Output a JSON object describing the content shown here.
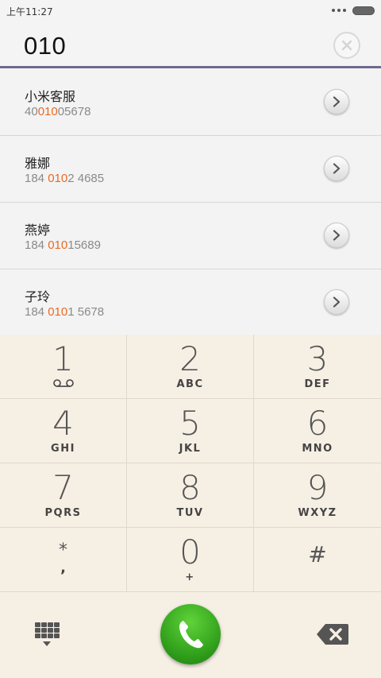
{
  "status_bar": {
    "time": "上午11:27",
    "more_icon": "dots-icon",
    "battery_icon": "battery-icon"
  },
  "dial": {
    "number": "010",
    "clear_icon": "close-icon"
  },
  "results": [
    {
      "name": "小米客服",
      "number_before": "40",
      "number_match": "010",
      "number_after": "05678"
    },
    {
      "name": "雅娜",
      "number_before": "184 ",
      "number_match": "010",
      "number_after": "2 4685"
    },
    {
      "name": "燕婷",
      "number_before": "184 ",
      "number_match": "010",
      "number_after": "15689"
    },
    {
      "name": "子玲",
      "number_before": "184 ",
      "number_match": "010",
      "number_after": "1 5678"
    }
  ],
  "keypad": {
    "keys": [
      {
        "digit": "1",
        "letters": ""
      },
      {
        "digit": "2",
        "letters": "ABC"
      },
      {
        "digit": "3",
        "letters": "DEF"
      },
      {
        "digit": "4",
        "letters": "GHI"
      },
      {
        "digit": "5",
        "letters": "JKL"
      },
      {
        "digit": "6",
        "letters": "MNO"
      },
      {
        "digit": "7",
        "letters": "PQRS"
      },
      {
        "digit": "8",
        "letters": "TUV"
      },
      {
        "digit": "9",
        "letters": "WXYZ"
      },
      {
        "digit": "*",
        "letters": ","
      },
      {
        "digit": "0",
        "letters": "+"
      },
      {
        "digit": "#",
        "letters": ""
      }
    ]
  },
  "bottom_bar": {
    "dialpad_icon": "dialpad-icon",
    "call_icon": "phone-icon",
    "backspace_icon": "backspace-icon"
  },
  "colors": {
    "match_highlight": "#ea6a20",
    "call_green": "#2c9a18",
    "keypad_bg": "#f6efe4",
    "divider_accent": "#6f6a8a"
  }
}
